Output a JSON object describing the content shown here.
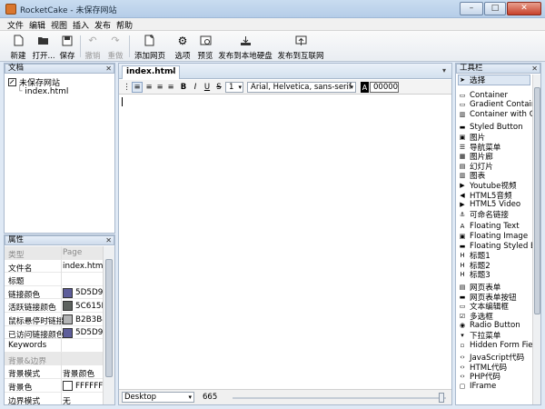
{
  "window": {
    "title": "RocketCake - 未保存网站",
    "colors": {
      "close_button": "#c7412b"
    }
  },
  "menu": [
    "文件",
    "编辑",
    "视图",
    "插入",
    "发布",
    "帮助"
  ],
  "toolbar": {
    "new": "新建",
    "open": "打开...",
    "save": "保存",
    "undo": "撤销",
    "redo": "重做",
    "add_page": "添加网页",
    "options": "选项",
    "preview": "预览",
    "publish_local": "发布到本地硬盘",
    "publish_web": "发布到互联网"
  },
  "docs_panel": {
    "title": "文档",
    "site": "未保存网站",
    "page": "index.html"
  },
  "props_panel": {
    "title": "属性",
    "rows": [
      {
        "key": "类型",
        "value": "Page",
        "grey": true
      },
      {
        "key": "文件名",
        "value": "index.html"
      },
      {
        "key": "标题",
        "value": ""
      },
      {
        "key": "链接颜色",
        "value": "5D5D9",
        "color": "#5d5d9a"
      },
      {
        "key": "活跃链接颜色",
        "value": "5C615E",
        "color": "#5c615e"
      },
      {
        "key": "鼠标悬停时链接",
        "value": "B2B3B4",
        "color": "#b2b3b4"
      },
      {
        "key": "已访问链接颜色",
        "value": "5D5D9",
        "color": "#5d5d9a"
      },
      {
        "key": "Keywords",
        "value": ""
      },
      {
        "key": "背景&边界",
        "value": "",
        "grey": true
      },
      {
        "key": "背景模式",
        "value": "背景颜色"
      },
      {
        "key": "背景色",
        "value": "FFFFFF",
        "color": "#ffffff"
      },
      {
        "key": "边界模式",
        "value": "无"
      }
    ]
  },
  "editor": {
    "tab": "index.html",
    "font_size": "1",
    "font_family": "Arial, Helvetica, sans-serif",
    "text_color": "000000",
    "device": "Desktop",
    "width": "665"
  },
  "tools_panel": {
    "title": "工具栏",
    "select": "选择",
    "items": [
      {
        "label": "Container",
        "icon": "container-icon"
      },
      {
        "label": "Gradient Container",
        "icon": "gradient-container-icon"
      },
      {
        "label": "Container with Co",
        "icon": "container-columns-icon"
      },
      {
        "label": "Styled Button",
        "icon": "button-icon"
      },
      {
        "label": "图片",
        "icon": "image-icon"
      },
      {
        "label": "导航菜单",
        "icon": "menu-icon"
      },
      {
        "label": "图片廊",
        "icon": "gallery-icon"
      },
      {
        "label": "幻灯片",
        "icon": "slideshow-icon"
      },
      {
        "label": "图表",
        "icon": "chart-icon"
      },
      {
        "label": "Youtube视频",
        "icon": "youtube-icon"
      },
      {
        "label": "HTML5音频",
        "icon": "audio-icon"
      },
      {
        "label": "HTML5 Video",
        "icon": "video-icon"
      },
      {
        "label": "可命名链接",
        "icon": "anchor-icon"
      },
      {
        "label": "Floating Text",
        "icon": "text-icon"
      },
      {
        "label": "Floating Image",
        "icon": "floating-image-icon"
      },
      {
        "label": "Floating Styled Bu",
        "icon": "floating-button-icon"
      },
      {
        "label": "标题1",
        "icon": "heading-icon"
      },
      {
        "label": "标题2",
        "icon": "heading-icon"
      },
      {
        "label": "标题3",
        "icon": "heading-icon"
      },
      {
        "label": "网页表单",
        "icon": "form-icon"
      },
      {
        "label": "网页表单按钮",
        "icon": "form-button-icon"
      },
      {
        "label": "文本编辑框",
        "icon": "textbox-icon"
      },
      {
        "label": "多选框",
        "icon": "checkbox-icon"
      },
      {
        "label": "Radio Button",
        "icon": "radio-icon"
      },
      {
        "label": "下拉菜单",
        "icon": "dropdown-icon"
      },
      {
        "label": "Hidden Form Fiel",
        "icon": "hidden-field-icon"
      },
      {
        "label": "JavaScript代码",
        "icon": "code-icon"
      },
      {
        "label": "HTML代码",
        "icon": "code-icon"
      },
      {
        "label": "PHP代码",
        "icon": "code-icon"
      },
      {
        "label": "IFrame",
        "icon": "iframe-icon"
      }
    ]
  }
}
